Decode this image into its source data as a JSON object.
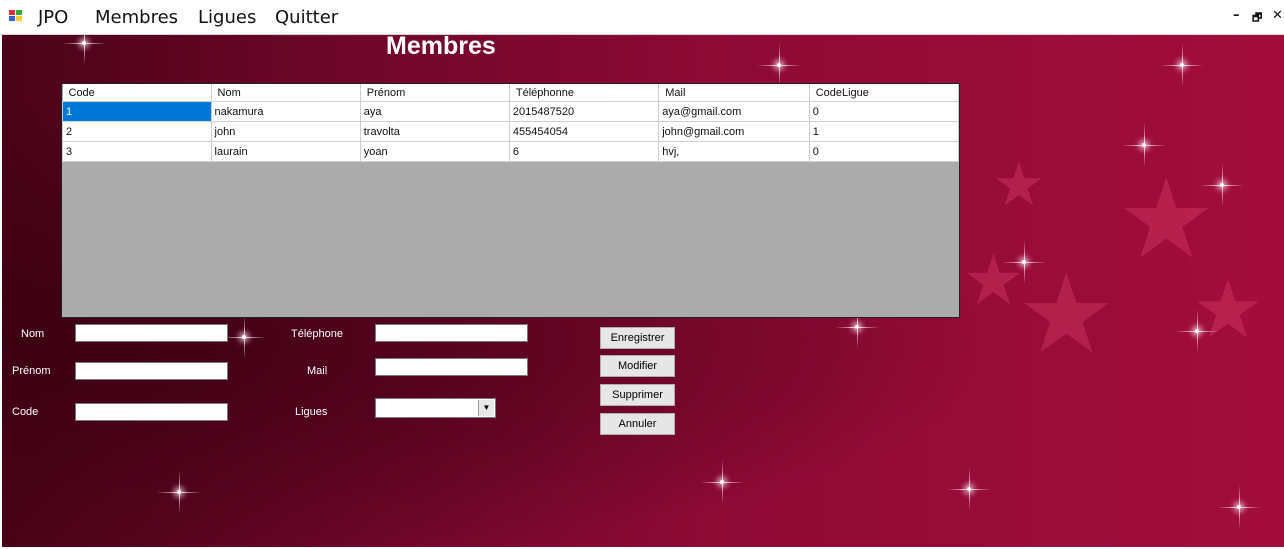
{
  "menubar": {
    "items": [
      "JPO",
      "Membres",
      "Ligues",
      "Quitter"
    ],
    "minimize_glyph": "–",
    "restore_glyph": "🗗",
    "close_glyph": "✕"
  },
  "title": "Membres",
  "grid": {
    "columns": [
      "Code",
      "Nom",
      "Prénom",
      "Téléphonne",
      "Mail",
      "CodeLigue"
    ],
    "rows": [
      [
        "1",
        "nakamura",
        "aya",
        "2015487520",
        "aya@gmail.com",
        "0"
      ],
      [
        "2",
        "john",
        "travolta",
        "455454054",
        "john@gmail.com",
        "1"
      ],
      [
        "3",
        "laurain",
        "yoan",
        "6",
        "hvj,",
        "0"
      ]
    ],
    "selected_row": 0
  },
  "form": {
    "nom_label": "Nom",
    "prenom_label": "Prénom",
    "code_label": "Code",
    "telephone_label": "Téléphone",
    "mail_label": "Mail",
    "ligues_label": "Ligues",
    "nom_value": "",
    "prenom_value": "",
    "code_value": "",
    "telephone_value": "",
    "mail_value": "",
    "ligues_value": ""
  },
  "buttons": {
    "save": "Enregistrer",
    "edit": "Modifier",
    "delete": "Supprimer",
    "cancel": "Annuler"
  },
  "colors": {
    "selection": "#0078d7",
    "background_dark": "#4a0318",
    "background_light": "#a30d3c",
    "grid_empty": "#ababab"
  }
}
